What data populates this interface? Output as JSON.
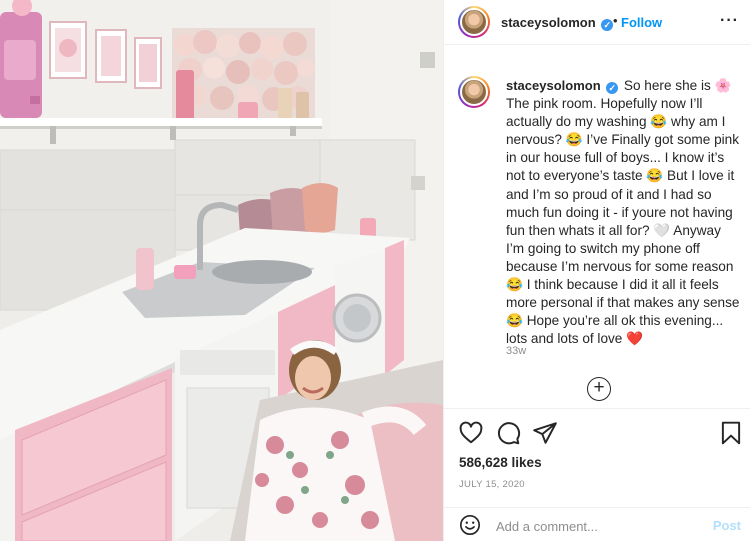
{
  "post": {
    "username": "staceysolomon",
    "verified_glyph": "✓",
    "separator": "•",
    "follow_label": "Follow",
    "more_glyph": "···",
    "caption": "So here she is 🌸 The pink room. Hopefully now I’ll actually do my washing 😂 why am I nervous? 😂 I’ve Finally got some pink in our house full of boys... I know it’s not to everyone’s taste 😂 But I love it and I’m so proud of it and I had so much fun doing it - if youre not having fun then whats it all for? 🤍 Anyway I’m going to switch my phone off because I’m nervous for some reason 😂 I think because I did it all it feels more personal if that makes any sense 😂 Hope you’re all ok this evening... lots and lots of love ❤️",
    "caption_prefix_emoji": "🌸",
    "time_ago": "33w",
    "load_more_glyph": "+",
    "likes": "586,628 likes",
    "date": "JULY 15, 2020"
  },
  "comment_box": {
    "placeholder": "Add a comment...",
    "post_label": "Post"
  },
  "icons": {
    "like": "heart-icon",
    "comment": "comment-icon",
    "share": "paper-plane-icon",
    "save": "bookmark-icon",
    "emoji": "smiley-icon",
    "load_more": "plus-circle-icon"
  },
  "colors": {
    "accent": "#0095f6",
    "verified": "#3897f0",
    "muted": "#8e8e8e",
    "post_disabled": "#b2dffc"
  }
}
